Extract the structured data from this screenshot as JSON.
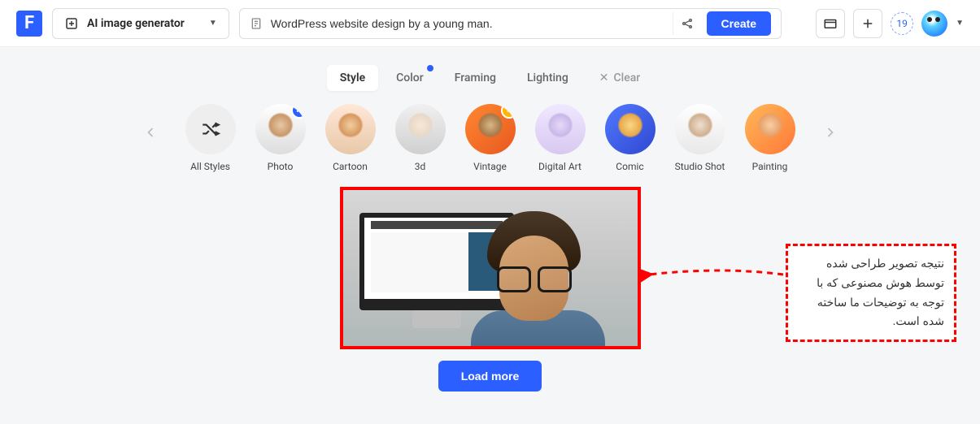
{
  "header": {
    "tool_label": "AI image generator",
    "prompt_value": "WordPress website design by a young man.",
    "create_label": "Create",
    "badge_count": "19"
  },
  "tabs": {
    "items": [
      {
        "label": "Style",
        "active": true
      },
      {
        "label": "Color",
        "has_dot": true
      },
      {
        "label": "Framing"
      },
      {
        "label": "Lighting"
      }
    ],
    "clear_label": "Clear"
  },
  "styles": {
    "items": [
      {
        "label": "All Styles",
        "icon": "shuffle"
      },
      {
        "label": "Photo",
        "selected": true
      },
      {
        "label": "Cartoon"
      },
      {
        "label": "3d"
      },
      {
        "label": "Vintage",
        "premium": true
      },
      {
        "label": "Digital Art"
      },
      {
        "label": "Comic"
      },
      {
        "label": "Studio Shot"
      },
      {
        "label": "Painting"
      }
    ]
  },
  "annotation": {
    "text": "نتیجه تصویر طراحی شده توسط هوش مصنوعی که با توجه به توضیحات ما ساخته شده است."
  },
  "load_more_label": "Load more"
}
